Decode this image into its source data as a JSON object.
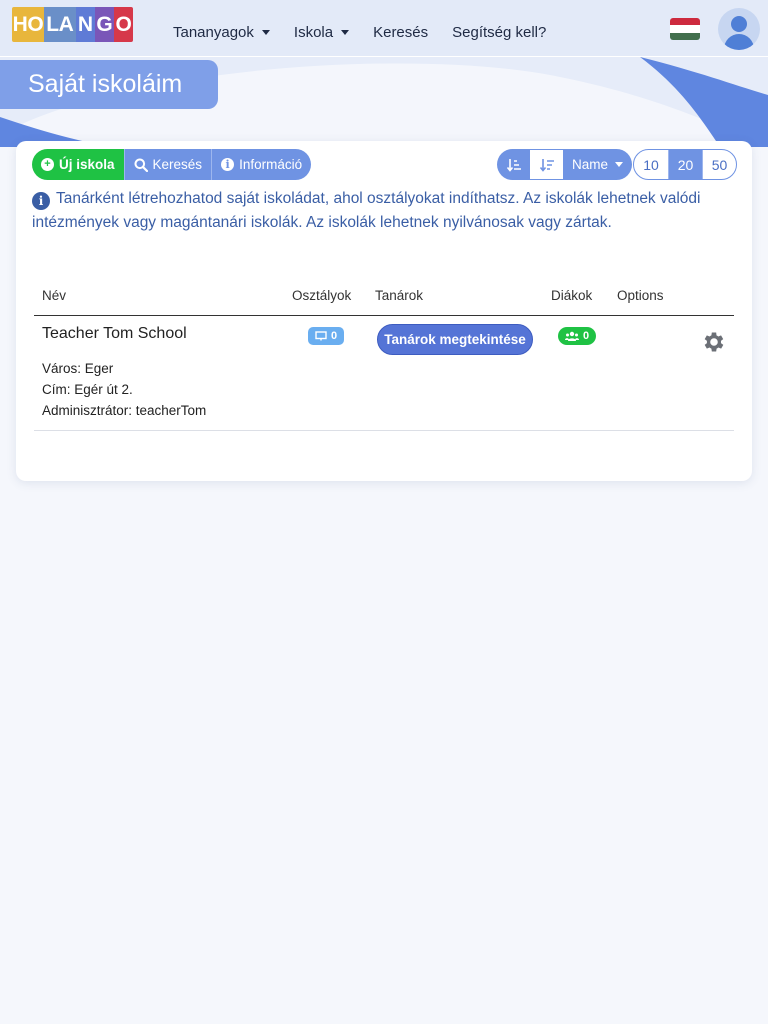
{
  "header": {
    "logo_letters": [
      "HO",
      "LA",
      "N",
      "G",
      "O"
    ],
    "logo_colors": [
      "#e8b63c",
      "#6a8fc8",
      "#5f7bd6",
      "#7a56b8",
      "#d6384a"
    ],
    "nav": [
      {
        "label": "Tananyagok",
        "dropdown": true
      },
      {
        "label": "Iskola",
        "dropdown": true
      },
      {
        "label": "Keresés",
        "dropdown": false
      },
      {
        "label": "Segítség kell?",
        "dropdown": false
      }
    ],
    "flag_colors": [
      "#cd2a3e",
      "#ffffff",
      "#436f4d"
    ],
    "avatar_icon": "user-icon"
  },
  "page": {
    "title": "Saját iskoláim"
  },
  "toolbar": {
    "new_school_label": "Új iskola",
    "search_label": "Keresés",
    "info_label": "Információ",
    "sort_asc_icon": "sort-ascending-icon",
    "sort_desc_icon": "sort-descending-icon",
    "sort_field_label": "Name",
    "page_sizes": [
      "10",
      "20",
      "50"
    ],
    "active_page_size": "20"
  },
  "info": {
    "text": "Tanárként létrehozhatod saját iskoládat, ahol osztályokat indíthatsz. Az iskolák lehetnek valódi intézmények vagy magántanári iskolák. Az iskolák lehetnek nyilvánosak vagy zártak."
  },
  "table": {
    "headers": {
      "name": "Név",
      "classes": "Osztályok",
      "teachers": "Tanárok",
      "students": "Diákok",
      "options": "Options"
    },
    "rows": [
      {
        "name": "Teacher Tom School",
        "city": "Város: Eger",
        "address": "Cím: Egér út 2.",
        "admin": "Adminisztrátor: teacherTom",
        "classes_count": "0",
        "teachers_button": "Tanárok megtekintése",
        "students_count": "0"
      }
    ]
  },
  "colors": {
    "accent": "#6f93e3",
    "success": "#1fc244",
    "info_text": "#3a5ea5"
  }
}
